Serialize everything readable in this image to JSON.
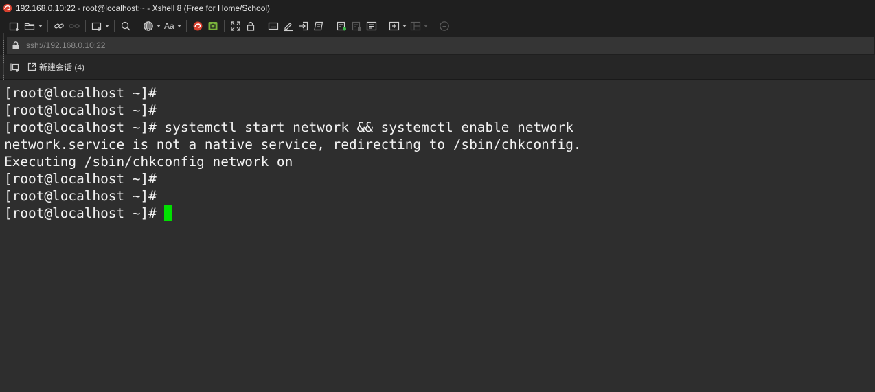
{
  "window": {
    "title": "192.168.0.10:22 - root@localhost:~ - Xshell 8 (Free for Home/School)",
    "app_icon": "xshell-logo-icon"
  },
  "toolbar": {
    "buttons": [
      {
        "name": "new-session-button",
        "icon": "new-session-icon"
      },
      {
        "name": "open-session-button",
        "icon": "folder-open-icon",
        "dropdown": true
      },
      {
        "name": "reconnect-button",
        "icon": "link-icon"
      },
      {
        "name": "disconnect-button",
        "icon": "unlink-icon",
        "disabled": true
      },
      {
        "name": "new-tab-button",
        "icon": "window-icon",
        "dropdown": true
      },
      {
        "name": "find-button",
        "icon": "search-icon"
      },
      {
        "name": "encoding-button",
        "icon": "globe-icon",
        "dropdown": true
      },
      {
        "name": "font-button",
        "label": "Aa",
        "dropdown": true
      },
      {
        "name": "xftp-button",
        "icon": "xftp-icon"
      },
      {
        "name": "xagent-button",
        "icon": "green-box-icon"
      },
      {
        "name": "fullscreen-button",
        "icon": "fullscreen-icon"
      },
      {
        "name": "lock-button",
        "icon": "padlock-icon"
      },
      {
        "name": "keyboard-button",
        "icon": "keyboard-icon"
      },
      {
        "name": "compose-button",
        "icon": "pen-icon"
      },
      {
        "name": "transfer-button",
        "icon": "transfer-icon"
      },
      {
        "name": "script-button",
        "icon": "script-icon"
      },
      {
        "name": "log-button",
        "icon": "log-icon"
      },
      {
        "name": "log-stop-button",
        "icon": "log-stop-icon",
        "disabled": true
      },
      {
        "name": "notes-button",
        "icon": "notes-icon"
      },
      {
        "name": "add-folder-button",
        "icon": "folder-add-icon",
        "dropdown": true
      },
      {
        "name": "layout-button",
        "icon": "layout-icon",
        "dropdown": true,
        "disabled": true
      },
      {
        "name": "chat-button",
        "icon": "chat-bubble-icon",
        "disabled": true
      }
    ],
    "font_label": "Aa"
  },
  "addressbar": {
    "value": "ssh://192.168.0.10:22",
    "icon": "lock-icon"
  },
  "tabs": {
    "session_manager_icon": "session-manager-icon",
    "new_tab_label": "新建会话 (4)"
  },
  "terminal": {
    "lines": [
      "[root@localhost ~]#",
      "[root@localhost ~]#",
      "[root@localhost ~]# systemctl start network && systemctl enable network",
      "network.service is not a native service, redirecting to /sbin/chkconfig.",
      "Executing /sbin/chkconfig network on",
      "[root@localhost ~]#",
      "[root@localhost ~]#",
      "[root@localhost ~]# "
    ],
    "cursor_color": "#00e000",
    "background": "#2e2e2e",
    "foreground": "#f2f2f2"
  }
}
